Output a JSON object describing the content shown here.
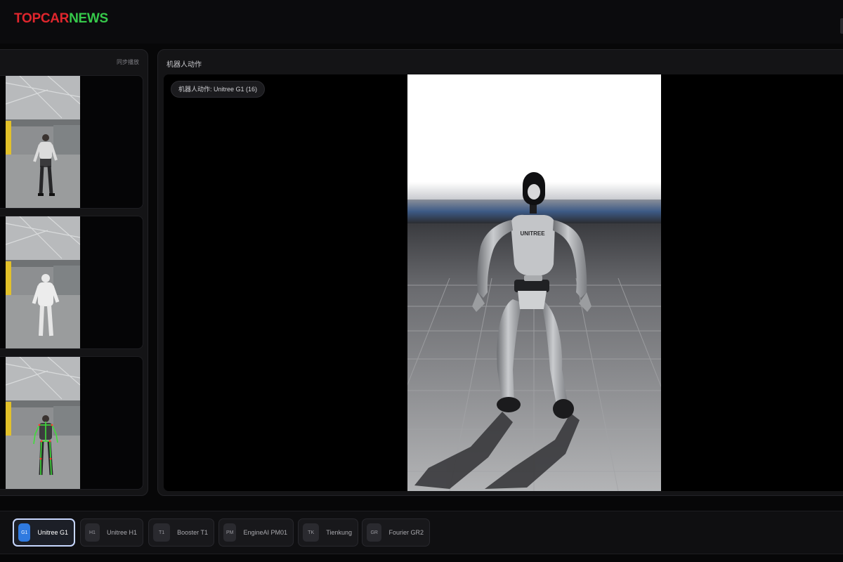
{
  "brand": {
    "part1": "TOPCAR",
    "part2": "NEWS"
  },
  "left_panel": {
    "header": "同步播放"
  },
  "main_panel": {
    "title": "机器人动作",
    "robot_label": "机器人动作: Unitree G1 (16)",
    "chest_logo": "UNITREE"
  },
  "robots": [
    {
      "code": "G1",
      "name": "Unitree G1",
      "active": true
    },
    {
      "code": "H1",
      "name": "Unitree H1",
      "active": false
    },
    {
      "code": "T1",
      "name": "Booster T1",
      "active": false
    },
    {
      "code": "PM",
      "name": "EngineAI PM01",
      "active": false
    },
    {
      "code": "TK",
      "name": "Tienkung",
      "active": false
    },
    {
      "code": "GR",
      "name": "Fourier GR2",
      "active": false
    }
  ],
  "colors": {
    "accent": "#2f7ae0",
    "skeleton": "#3fdc3a",
    "logo_red": "#e0262d",
    "logo_green": "#36c94a"
  }
}
